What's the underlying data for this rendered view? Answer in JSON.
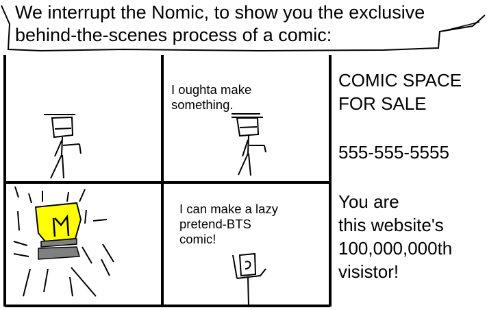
{
  "banner": {
    "line1": "We interrupt the Nomic, to show you the exclusive",
    "line2": "behind-the-scenes process of a comic:"
  },
  "panels": {
    "p2_line1": "I oughta make",
    "p2_line2": "something.",
    "p4_line1": "I can make a lazy",
    "p4_line2": "pretend-BTS",
    "p4_line3": "comic!"
  },
  "ad": {
    "line1": "COMIC SPACE",
    "line2": "FOR SALE",
    "phone": "555-555-5555",
    "msg1": "You are",
    "msg2": "this website's",
    "msg3": "100,000,000th",
    "msg4": "visistor!"
  },
  "colors": {
    "ink": "#000000",
    "lightbulb": "#ffff00",
    "bulb_base": "#808080",
    "paper": "#ffffff"
  }
}
